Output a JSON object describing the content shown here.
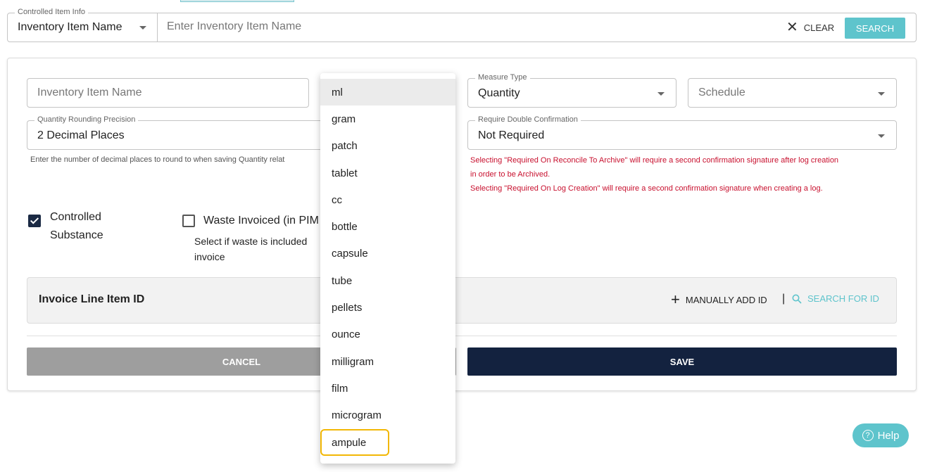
{
  "search": {
    "legend": "Controlled Item Info",
    "type_value": "Inventory Item Name",
    "placeholder": "Enter Inventory Item Name",
    "clear_label": "CLEAR",
    "search_label": "SEARCH"
  },
  "form": {
    "item_name_placeholder": "Inventory Item Name",
    "measure_type": {
      "legend": "Measure Type",
      "value": "Quantity"
    },
    "schedule_placeholder": "Schedule",
    "rounding": {
      "legend": "Quantity Rounding Precision",
      "value": "2 Decimal Places",
      "helper": "Enter the number of decimal places to round to when saving Quantity relat"
    },
    "double_confirm": {
      "legend": "Require Double Confirmation",
      "value": "Not Required",
      "warning_1a": "Selecting \"Required On Reconcile To Archive\" will require a second confirmation signature after log creation",
      "warning_1b": "in order to be Archived.",
      "warning_2": "Selecting \"Required On Log Creation\" will require a second confirmation signature when creating a log."
    },
    "controlled_substance": {
      "line1": "Controlled",
      "line2": "Substance",
      "checked": true
    },
    "waste_invoiced": {
      "label": "Waste Invoiced (in PIM",
      "help1": "Select if waste is included",
      "help2": "invoice",
      "checked": false
    },
    "invoice_panel": {
      "title": "Invoice Line Item ID",
      "manual_add_label": "MANUALLY ADD ID",
      "separator": "|",
      "search_id_label": "SEARCH FOR ID"
    },
    "cancel_label": "CANCEL",
    "save_label": "SAVE"
  },
  "dropdown": {
    "options": [
      "ml",
      "gram",
      "patch",
      "tablet",
      "cc",
      "bottle",
      "capsule",
      "tube",
      "pellets",
      "ounce",
      "milligram",
      "film",
      "microgram",
      "ampule"
    ],
    "selected": "ml",
    "highlighted": "ampule"
  },
  "help": {
    "label": "Help"
  },
  "colors": {
    "accent": "#5ec4cc",
    "primary": "#13223f",
    "warning": "#c8102e",
    "highlight": "#f2b705"
  }
}
